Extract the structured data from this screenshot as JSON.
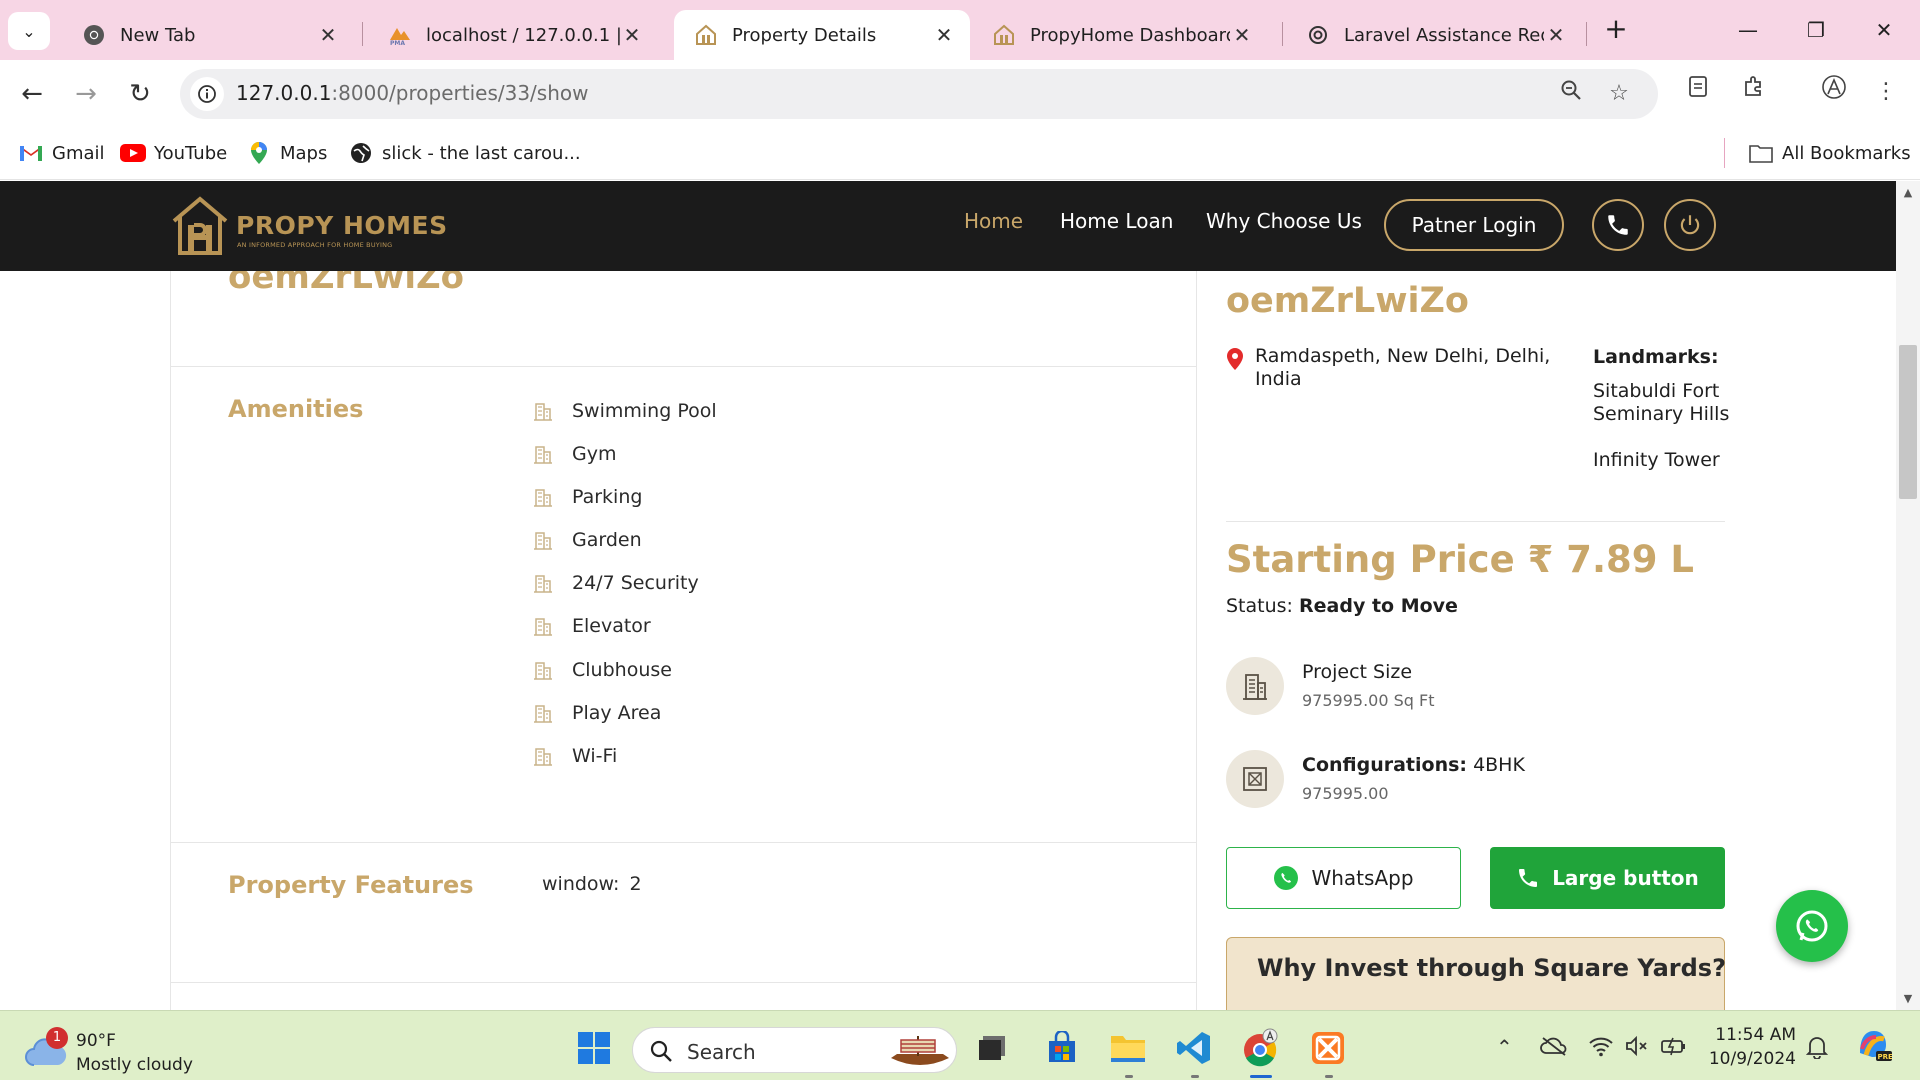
{
  "browser": {
    "tabs": [
      {
        "title": "New Tab",
        "icon": "chrome-icon",
        "active": false
      },
      {
        "title": "localhost / 127.0.0.1 | php",
        "icon": "phpmyadmin-icon",
        "active": false
      },
      {
        "title": "Property Details",
        "icon": "propy-icon",
        "active": true
      },
      {
        "title": "PropyHome Dashboard",
        "icon": "propy-icon",
        "active": false
      },
      {
        "title": "Laravel Assistance Reque",
        "icon": "openai-icon",
        "active": false
      }
    ],
    "url_host": "127.0.0.1",
    "url_rest": ":8000/properties/33/show",
    "bookmarks": [
      {
        "label": "Gmail",
        "icon": "gmail-icon"
      },
      {
        "label": "YouTube",
        "icon": "youtube-icon"
      },
      {
        "label": "Maps",
        "icon": "maps-icon"
      },
      {
        "label": "slick - the last carou...",
        "icon": "globe-icon"
      }
    ],
    "all_bookmarks": "All Bookmarks"
  },
  "site": {
    "logo_name": "PROPY HOMES",
    "logo_tagline": "AN INFORMED APPROACH FOR HOME BUYING",
    "nav": [
      "Home",
      "Home Loan",
      "Why Choose Us"
    ],
    "login_label": "Patner Login",
    "brand_color": "#c9a76a"
  },
  "property": {
    "title": "oemZrLwiZo",
    "amenities_heading": "Amenities",
    "amenities": [
      "Swimming Pool",
      "Gym",
      "Parking",
      "Garden",
      "24/7 Security",
      "Elevator",
      "Clubhouse",
      "Play Area",
      "Wi-Fi"
    ],
    "features_heading": "Property Features",
    "features": [
      {
        "name": "window:",
        "value": "2"
      }
    ],
    "address": "Ramdaspeth, New Delhi, Delhi, India",
    "landmarks_heading": "Landmarks:",
    "landmarks": [
      "Sitabuldi Fort",
      "Seminary Hills",
      "Infinity Tower"
    ],
    "price": "Starting Price ₹ 7.89 L",
    "status_label": "Status:",
    "status_value": "Ready to Move",
    "project_size_label": "Project Size",
    "project_size_value": "975995.00 Sq Ft",
    "config_label": "Configurations:",
    "config_value": "4BHK",
    "config_sub": "975995.00",
    "whatsapp_label": "WhatsApp",
    "large_button_label": "Large button",
    "invest_heading": "Why Invest through Square Yards?"
  },
  "taskbar": {
    "weather_temp": "90°F",
    "weather_desc": "Mostly cloudy",
    "weather_badge": "1",
    "search_label": "Search",
    "time": "11:54 AM",
    "date": "10/9/2024"
  }
}
